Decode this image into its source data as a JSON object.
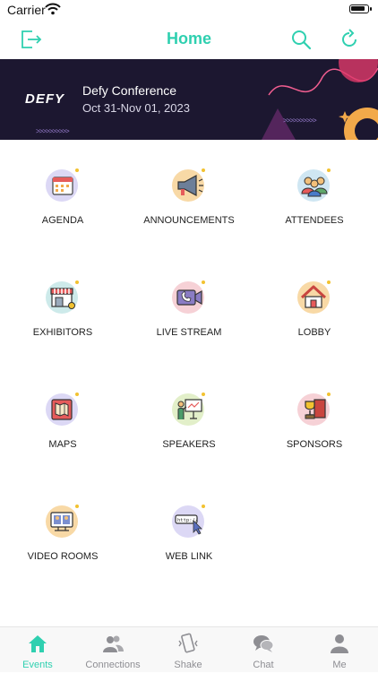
{
  "status": {
    "carrier": "Carrier"
  },
  "nav": {
    "title": "Home"
  },
  "event": {
    "logo": "DEFY",
    "name": "Defy Conference",
    "dates": "Oct 31-Nov 01, 2023"
  },
  "tiles": [
    {
      "label": "AGENDA",
      "icon": "calendar-icon"
    },
    {
      "label": "ANNOUNCEMENTS",
      "icon": "megaphone-icon"
    },
    {
      "label": "ATTENDEES",
      "icon": "people-icon"
    },
    {
      "label": "EXHIBITORS",
      "icon": "storefront-icon"
    },
    {
      "label": "LIVE STREAM",
      "icon": "video-call-icon"
    },
    {
      "label": "LOBBY",
      "icon": "house-icon"
    },
    {
      "label": "MAPS",
      "icon": "map-icon"
    },
    {
      "label": "SPEAKERS",
      "icon": "presenter-icon"
    },
    {
      "label": "SPONSORS",
      "icon": "trophy-icon"
    },
    {
      "label": "VIDEO ROOMS",
      "icon": "video-rooms-icon"
    },
    {
      "label": "WEB LINK",
      "icon": "web-link-icon"
    }
  ],
  "tabs": [
    {
      "label": "Events",
      "active": true,
      "icon": "house-icon"
    },
    {
      "label": "Connections",
      "active": false,
      "icon": "connections-icon"
    },
    {
      "label": "Shake",
      "active": false,
      "icon": "shake-phone-icon"
    },
    {
      "label": "Chat",
      "active": false,
      "icon": "chat-bubbles-icon"
    },
    {
      "label": "Me",
      "active": false,
      "icon": "person-icon"
    }
  ],
  "colors": {
    "accent": "#2fd0b0",
    "banner_bg": "#1c1730",
    "tab_inactive": "#8e8e93"
  }
}
